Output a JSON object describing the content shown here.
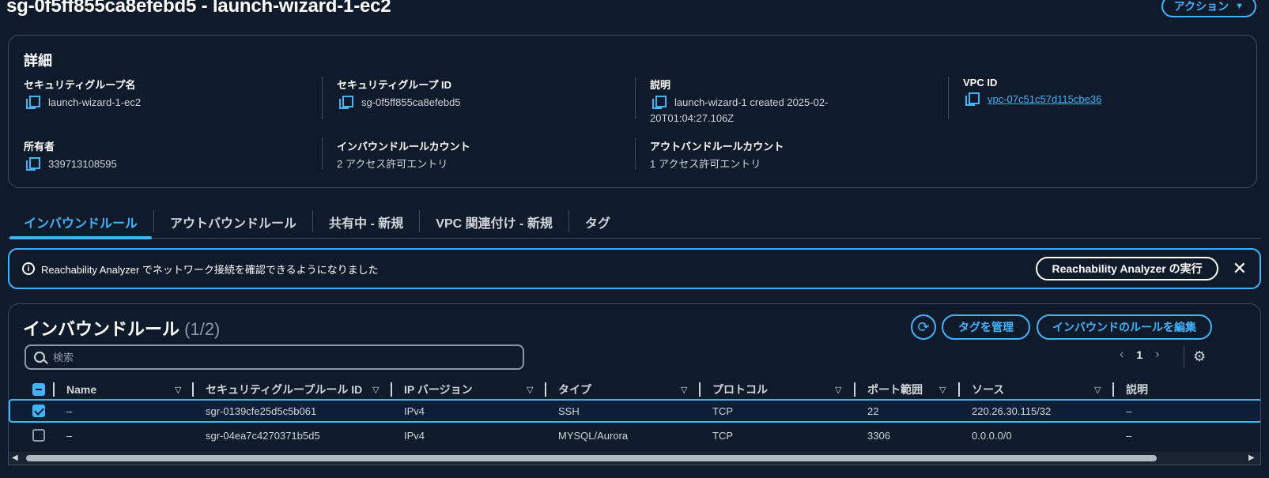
{
  "header": {
    "title": "sg-0f5ff855ca8efebd5 - launch-wizard-1-ec2",
    "action_label": "アクション",
    "action_caret": "▼"
  },
  "details": {
    "title": "詳細",
    "fields": {
      "sg_name": {
        "label": "セキュリティグループ名",
        "value": "launch-wizard-1-ec2"
      },
      "sg_id": {
        "label": "セキュリティグループ ID",
        "value": "sg-0f5ff855ca8efebd5"
      },
      "description": {
        "label": "説明",
        "value_line1": "launch-wizard-1 created 2025-02-",
        "value_line2": "20T01:04:27.106Z"
      },
      "vpc_id": {
        "label": "VPC ID",
        "value": "vpc-07c51c57d115cbe36"
      },
      "owner": {
        "label": "所有者",
        "value": "339713108595"
      },
      "inbound_count": {
        "label": "インバウンドルールカウント",
        "value": "2 アクセス許可エントリ"
      },
      "outbound_count": {
        "label": "アウトバンドルールカウント",
        "value": "1 アクセス許可エントリ"
      }
    }
  },
  "tabs": [
    {
      "label": "インバウンドルール",
      "active": true
    },
    {
      "label": "アウトバウンドルール",
      "active": false
    },
    {
      "label": "共有中 - 新規",
      "active": false
    },
    {
      "label": "VPC 関連付け - 新規",
      "active": false
    },
    {
      "label": "タグ",
      "active": false
    }
  ],
  "banner": {
    "info_glyph": "i",
    "text": "Reachability Analyzer でネットワーク接続を確認できるようになりました",
    "button_label": "Reachability Analyzer の実行",
    "close_glyph": "✕"
  },
  "rules": {
    "title": "インバウンドルール",
    "count": "(1/2)",
    "refresh_glyph": "⟳",
    "manage_tags_label": "タグを管理",
    "edit_rules_label": "インバウンドのルールを編集",
    "search_placeholder": "検索",
    "pager": {
      "prev": "‹",
      "page": "1",
      "next": "›"
    },
    "settings_glyph": "⚙",
    "columns": [
      "Name",
      "セキュリティグループルール ID",
      "IP バージョン",
      "タイプ",
      "プロトコル",
      "ポート範囲",
      "ソース",
      "説明"
    ],
    "sort_glyph": "▽",
    "rows": [
      {
        "selected": true,
        "name": "–",
        "rule_id": "sgr-0139cfe25d5c5b061",
        "ip_version": "IPv4",
        "type": "SSH",
        "protocol": "TCP",
        "port_range": "22",
        "source": "220.26.30.115/32",
        "description": "–"
      },
      {
        "selected": false,
        "name": "–",
        "rule_id": "sgr-04ea7c4270371b5d5",
        "ip_version": "IPv4",
        "type": "MYSQL/Aurora",
        "protocol": "TCP",
        "port_range": "3306",
        "source": "0.0.0.0/0",
        "description": "–"
      }
    ],
    "scroll_left": "◀",
    "scroll_right": "▶"
  },
  "colors": {
    "background": "#0f1b2a",
    "accent": "#42b4ff",
    "border": "#414d5c",
    "text": "#d1d5db",
    "heading": "#ffffff"
  }
}
